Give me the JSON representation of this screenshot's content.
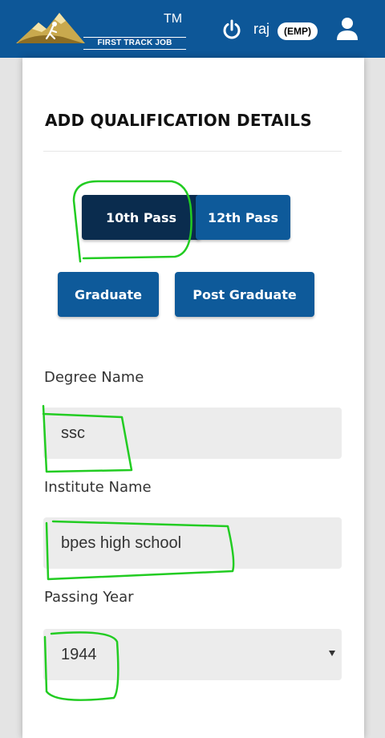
{
  "header": {
    "logo_brand": "FIRST TRACK JOB",
    "logo_tm": "TM",
    "user_name": "raj",
    "role_badge": "(EMP)",
    "background_color": "#0d5798"
  },
  "icons": {
    "logout": "power-icon",
    "profile": "user-icon",
    "select": "caret-down-icon"
  },
  "form": {
    "title": "ADD QUALIFICATION DETAILS",
    "qualification_options": [
      {
        "label": "10th Pass",
        "selected": true
      },
      {
        "label": "12th Pass",
        "selected": false
      },
      {
        "label": "Graduate",
        "selected": false
      },
      {
        "label": "Post Graduate",
        "selected": false
      }
    ],
    "degree_label": "Degree Name",
    "degree_value": "ssc",
    "institute_label": "Institute Name",
    "institute_value": "bpes high school",
    "year_label": "Passing Year",
    "year_value": "1944"
  },
  "colors": {
    "button": "#0e5a9a",
    "button_selected": "#0a2c4e",
    "annotation": "#22cc22",
    "field_background": "#ececec"
  }
}
